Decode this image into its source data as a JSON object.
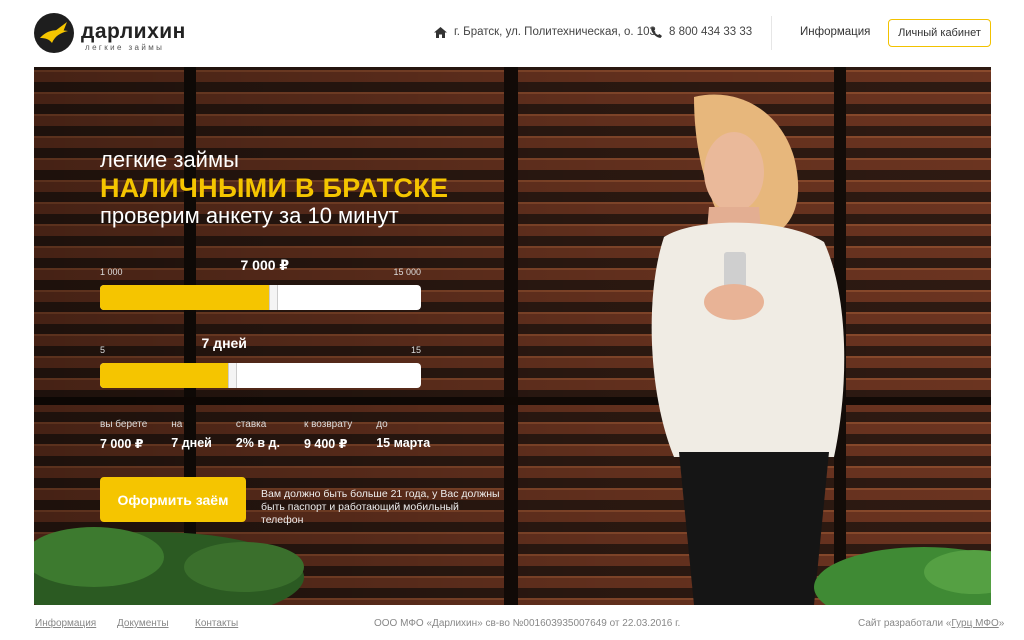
{
  "header": {
    "logo_name": "дарлихин",
    "logo_tagline": "легкие займы",
    "address": "г. Братск, ул. Политехническая, о. 103",
    "phone": "8 800 434 33 33",
    "info_label": "Информация",
    "cabinet_label": "Личный кабинет"
  },
  "hero": {
    "line1": "легкие займы",
    "line2": "НАЛИЧНЫМИ В БРАТСКЕ",
    "line3": "проверим анкету за 10 минут"
  },
  "amount_slider": {
    "min_label": "1 000",
    "max_label": "15 000",
    "value_label": "7 000 ₽",
    "fraction": 0.54
  },
  "term_slider": {
    "min_label": "5",
    "max_label": "15",
    "value_label": "7 дней",
    "fraction": 0.41
  },
  "summary": [
    {
      "label": "вы берете",
      "value": "7 000 ₽"
    },
    {
      "label": "на",
      "value": "7 дней"
    },
    {
      "label": "ставка",
      "value": "2% в д."
    },
    {
      "label": "к возврату",
      "value": "9 400 ₽"
    },
    {
      "label": "до",
      "value": "15 марта"
    }
  ],
  "apply_button": "Оформить заём",
  "note": "Вам должно быть больше 21 года, у Вас должны быть паспорт и работающий мобильный телефон",
  "footer": {
    "info": "Информация",
    "documents": "Документы",
    "contacts": "Контакты",
    "copyright": "ООО МФО «Дарлихин» св-во №001603935007649 от 22.03.2016 г.",
    "dev_prefix": "Сайт разработали «",
    "dev_name": "Гурц МФО",
    "dev_suffix": "»"
  },
  "colors": {
    "accent": "#f5c500",
    "hero_bg": "#2a1a14",
    "slats": "#6b3420"
  },
  "icons": {
    "logo": "bird-logo-icon",
    "address": "home-icon",
    "phone": "phone-icon"
  }
}
